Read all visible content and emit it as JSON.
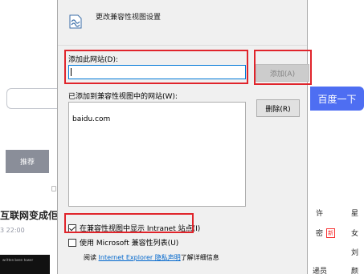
{
  "background": {
    "search_button": "百度一下",
    "tab_label": "推荐",
    "headline": "互联网变成佢",
    "time": "3 22:00",
    "black_strip_text": "written been tower",
    "right_column": [
      {
        "text": "许",
        "style": "normal"
      },
      {
        "text": "星",
        "style": "normal"
      },
      {
        "text": "密",
        "style": "normal"
      },
      {
        "text": "新",
        "style": "badge"
      },
      {
        "text": "女",
        "style": "normal"
      },
      {
        "text": "刘",
        "style": "normal"
      },
      {
        "text": "递员",
        "style": "normal"
      },
      {
        "text": "颜",
        "style": "normal"
      }
    ]
  },
  "dialog": {
    "title": "更改兼容性视图设置",
    "add_label": "添加此网站(D):",
    "add_input_value": "",
    "add_button": "添加(A)",
    "list_label": "已添加到兼容性视图中的网站(W):",
    "sites": [
      "baidu.com"
    ],
    "delete_button": "删除(R)",
    "intranet_checkbox": {
      "label": "在兼容性视图中显示 Intranet 站点(I)",
      "checked": true
    },
    "microsoft_list_checkbox": {
      "label": "使用 Microsoft 兼容性列表(U)",
      "checked": false
    },
    "privacy_prefix": "阅读 ",
    "privacy_link": "Internet Explorer 隐私声明",
    "privacy_suffix": "了解详细信息"
  },
  "colors": {
    "annotation": "#e0242b",
    "baidu_blue": "#4e6ef2",
    "link": "#0066cc"
  }
}
